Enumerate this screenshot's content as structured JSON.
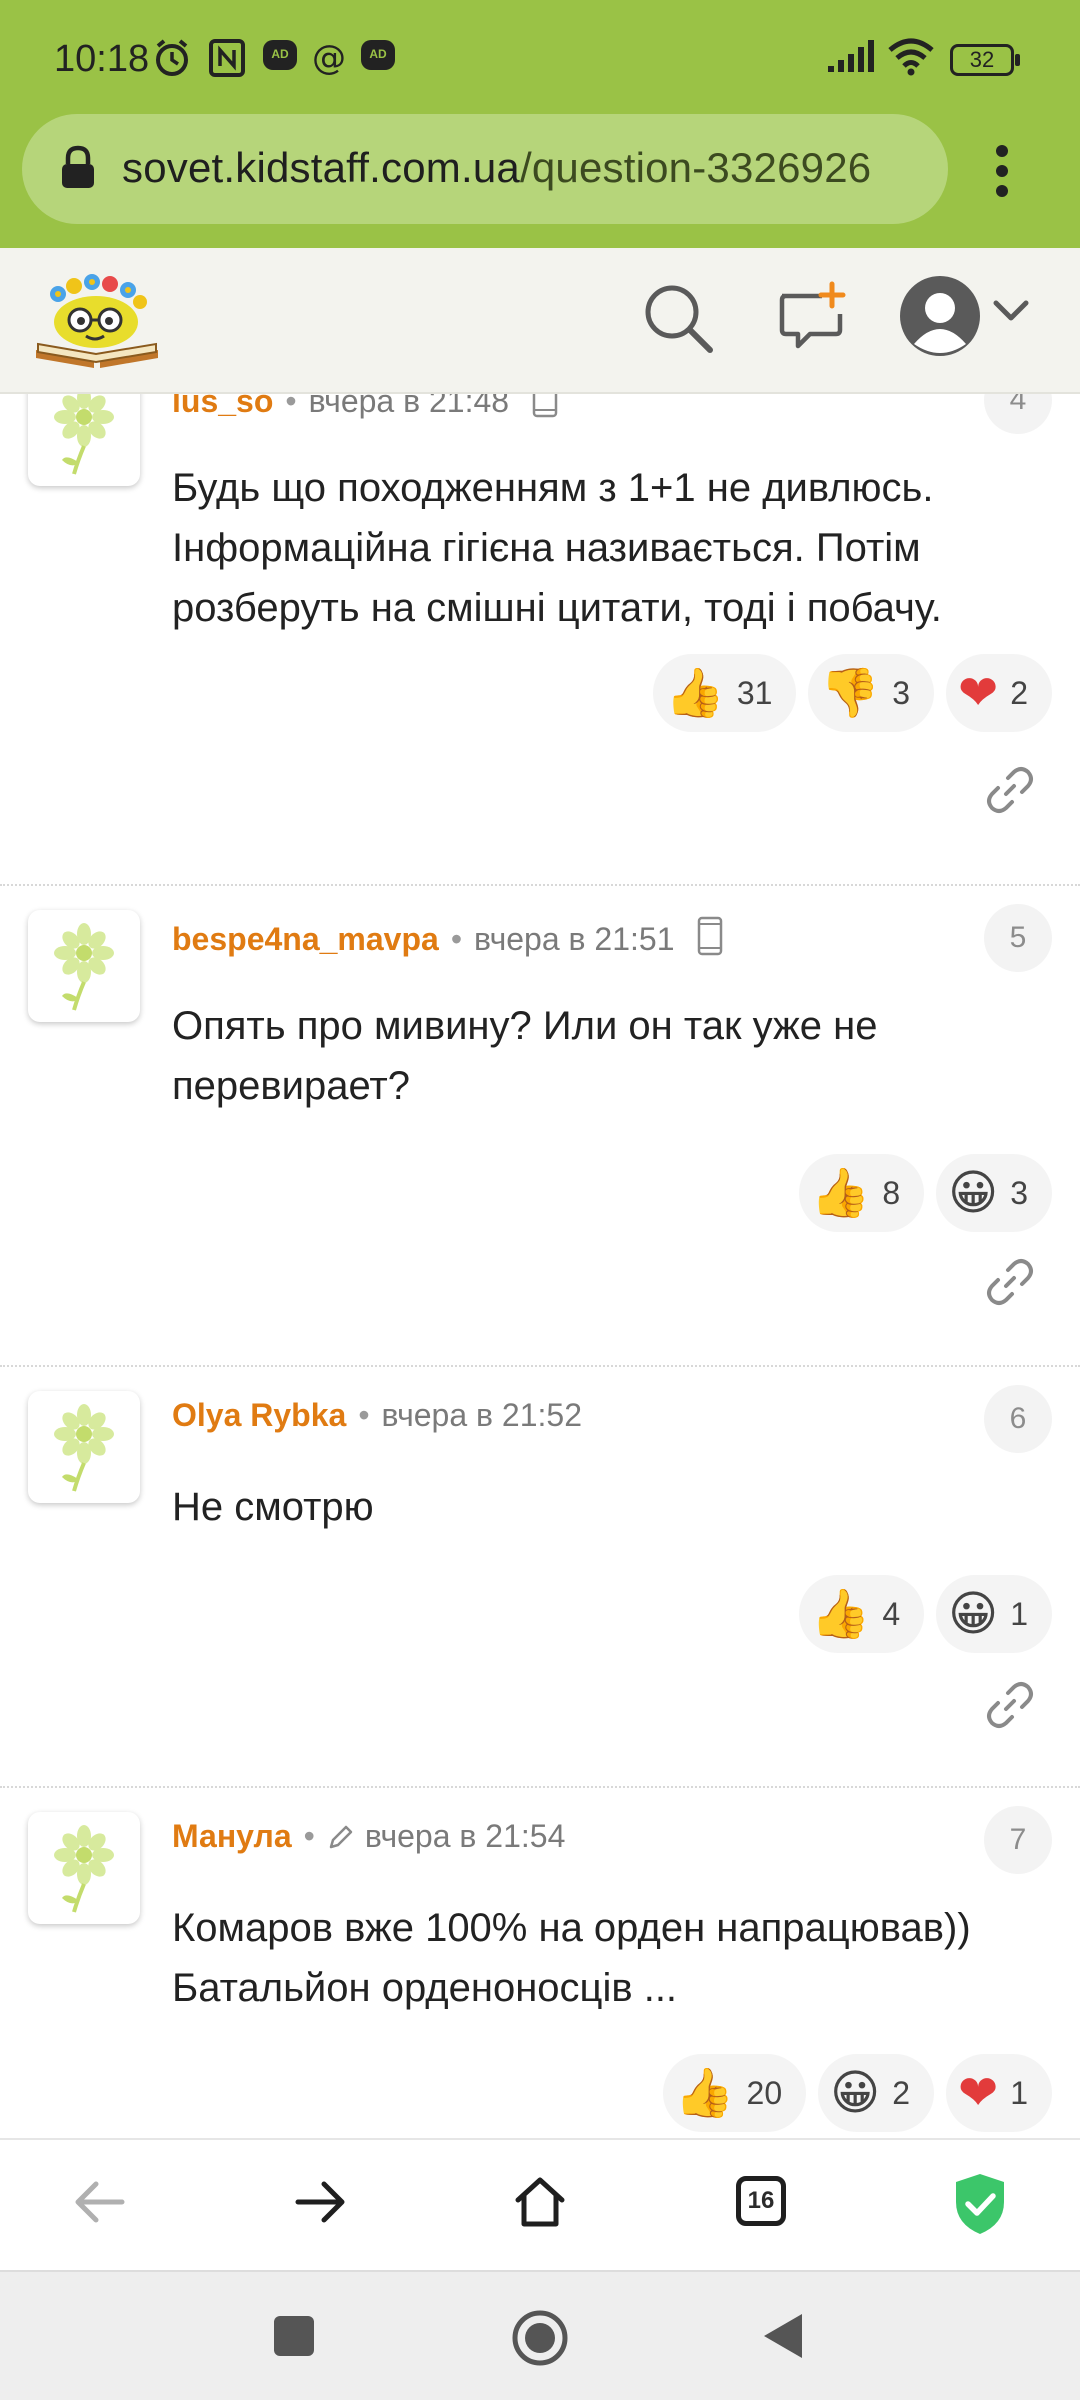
{
  "status_bar": {
    "time": "10:18",
    "battery": "32"
  },
  "browser": {
    "url_domain": "sovet.kidstaff.com.ua",
    "url_path": "/question-3326926",
    "tabs_count": "16"
  },
  "comments": [
    {
      "author": "lus_so",
      "time": "вчера в 21:48",
      "number": "4",
      "text": "Будь що походженням з 1+1 не дивлюсь. Інформаційна гігієна називається. Потім розберуть на смішні цитати, тоді і побачу.",
      "reactions": [
        {
          "icon": "thumbs-up",
          "count": "31"
        },
        {
          "icon": "thumbs-down",
          "count": "3"
        },
        {
          "icon": "heart",
          "count": "2"
        }
      ]
    },
    {
      "author": "bespe4na_mavpa",
      "time": "вчера в 21:51",
      "number": "5",
      "text": "Опять про мивину? Или он так уже не перевирает?",
      "reactions": [
        {
          "icon": "thumbs-up",
          "count": "8"
        },
        {
          "icon": "grinning-face",
          "count": "3"
        }
      ]
    },
    {
      "author": "Olya Rybka",
      "time": "вчера в 21:52",
      "number": "6",
      "text": "Не смотрю",
      "reactions": [
        {
          "icon": "thumbs-up",
          "count": "4"
        },
        {
          "icon": "grinning-face",
          "count": "1"
        }
      ]
    },
    {
      "author": "Манула",
      "time": "вчера в 21:54",
      "number": "7",
      "text": "Комаров вже 100% на орден напрацював)) Батальйон орденоносців ...",
      "reactions": [
        {
          "icon": "thumbs-up",
          "count": "20"
        },
        {
          "icon": "grinning-face",
          "count": "2"
        },
        {
          "icon": "heart",
          "count": "1"
        }
      ]
    }
  ],
  "colors": {
    "brand_green": "#9ac246",
    "author_orange": "#e07b12",
    "shield_green": "#3cc66a"
  }
}
